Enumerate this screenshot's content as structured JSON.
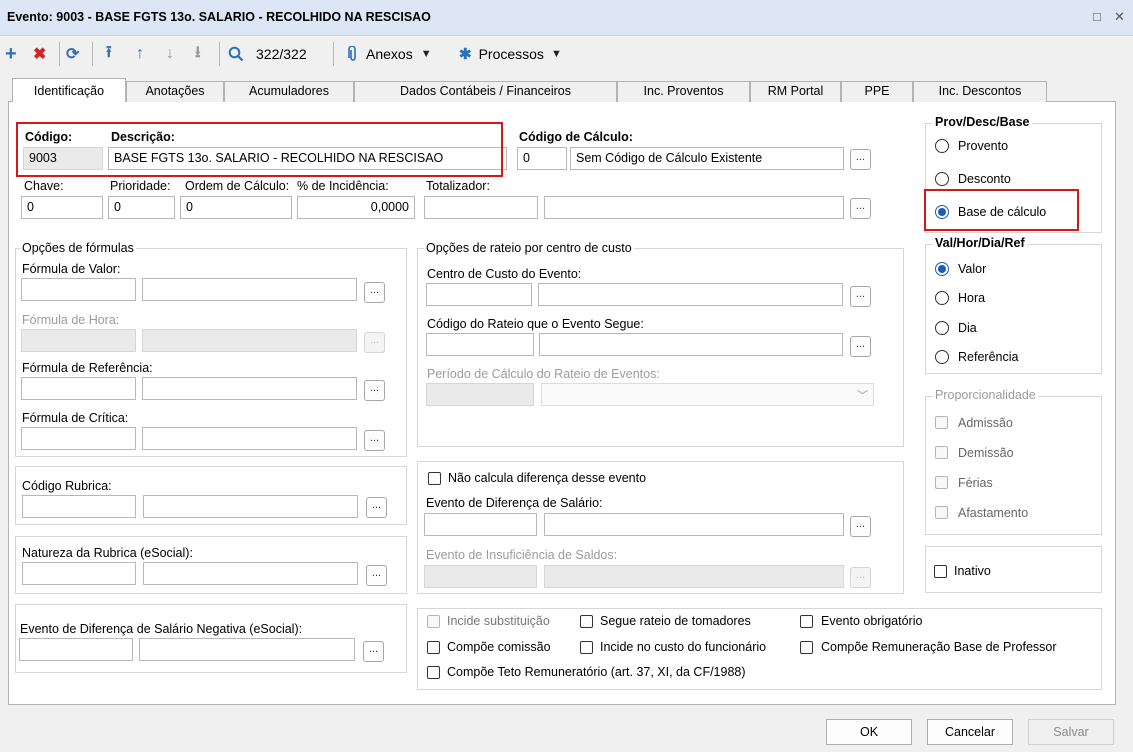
{
  "window": {
    "title": "Evento: 9003 - BASE FGTS 13o. SALARIO - RECOLHIDO NA RESCISAO",
    "restore_glyph": "□",
    "close_glyph": "✕"
  },
  "toolbar": {
    "add": "+",
    "delete": "✖",
    "refresh": "⟳",
    "first": "⭱",
    "prev": "↑",
    "next": "↓",
    "last": "⭳",
    "record_counter": "322/322",
    "anexos_label": "Anexos",
    "processos_label": "Processos"
  },
  "tabs": [
    "Identificação",
    "Anotações",
    "Acumuladores",
    "Dados Contábeis / Financeiros",
    "Inc. Proventos",
    "RM Portal",
    "PPE",
    "Inc. Descontos"
  ],
  "ident": {
    "codigo_label": "Código:",
    "codigo_value": "9003",
    "descricao_label": "Descrição:",
    "descricao_value": "BASE FGTS 13o. SALARIO - RECOLHIDO NA RESCISAO",
    "codigo_calculo_label": "Código de Cálculo:",
    "codigo_calculo_value": "0",
    "codigo_calculo_desc": "Sem Código de Cálculo Existente",
    "chave_label": "Chave:",
    "chave_value": "0",
    "prioridade_label": "Prioridade:",
    "prioridade_value": "0",
    "ordem_label": "Ordem de Cálculo:",
    "ordem_value": "0",
    "incidencia_label": "% de Incidência:",
    "incidencia_value": "0,0000",
    "totalizador_label": "Totalizador:"
  },
  "formulas": {
    "title": "Opções de fórmulas",
    "valor_label": "Fórmula de Valor:",
    "hora_label": "Fórmula de Hora:",
    "referencia_label": "Fórmula de Referência:",
    "critica_label": "Fórmula de Crítica:"
  },
  "rateio": {
    "title": "Opções de rateio por centro de custo",
    "centro_label": "Centro de Custo do Evento:",
    "codigo_rateio_label": "Código do Rateio que o Evento Segue:",
    "periodo_label": "Período de Cálculo do Rateio de Eventos:"
  },
  "rubrica": {
    "codigo_label": "Código Rubrica:",
    "natureza_label": "Natureza da Rubrica (eSocial):",
    "dif_negativa_label": "Evento de Diferença de Salário Negativa (eSocial):"
  },
  "diferenca": {
    "nao_calcula_label": "Não calcula diferença desse evento",
    "evento_dif_label": "Evento de Diferença de Salário:",
    "insuficiencia_label": "Evento de Insuficiência de Saldos:"
  },
  "prov": {
    "title": "Prov/Desc/Base",
    "options": [
      "Provento",
      "Desconto",
      "Base de cálculo"
    ],
    "selected": "Base de cálculo"
  },
  "vhdr": {
    "title": "Val/Hor/Dia/Ref",
    "options": [
      "Valor",
      "Hora",
      "Dia",
      "Referência"
    ],
    "selected": "Valor"
  },
  "proporcionalidade": {
    "title": "Proporcionalidade",
    "options": [
      "Admissão",
      "Demissão",
      "Férias",
      "Afastamento"
    ]
  },
  "inativo_label": "Inativo",
  "flags": {
    "incide_substituicao": "Incide substituição",
    "segue_rateio": "Segue rateio de tomadores",
    "evento_obrigatorio": "Evento obrigatório",
    "compoe_comissao": "Compõe comissão",
    "incide_custo": "Incide no custo do funcionário",
    "compoe_base_professor": "Compõe Remuneração Base de Professor",
    "compoe_teto": "Compõe Teto Remuneratório (art. 37, XI, da CF/1988)"
  },
  "buttons": {
    "ok": "OK",
    "cancel": "Cancelar",
    "save": "Salvar"
  },
  "ellipsis": "...",
  "colors": {
    "accent": "#1c5cb6",
    "highlight_border": "#d6181d",
    "titlebar": "#dce6f4"
  }
}
